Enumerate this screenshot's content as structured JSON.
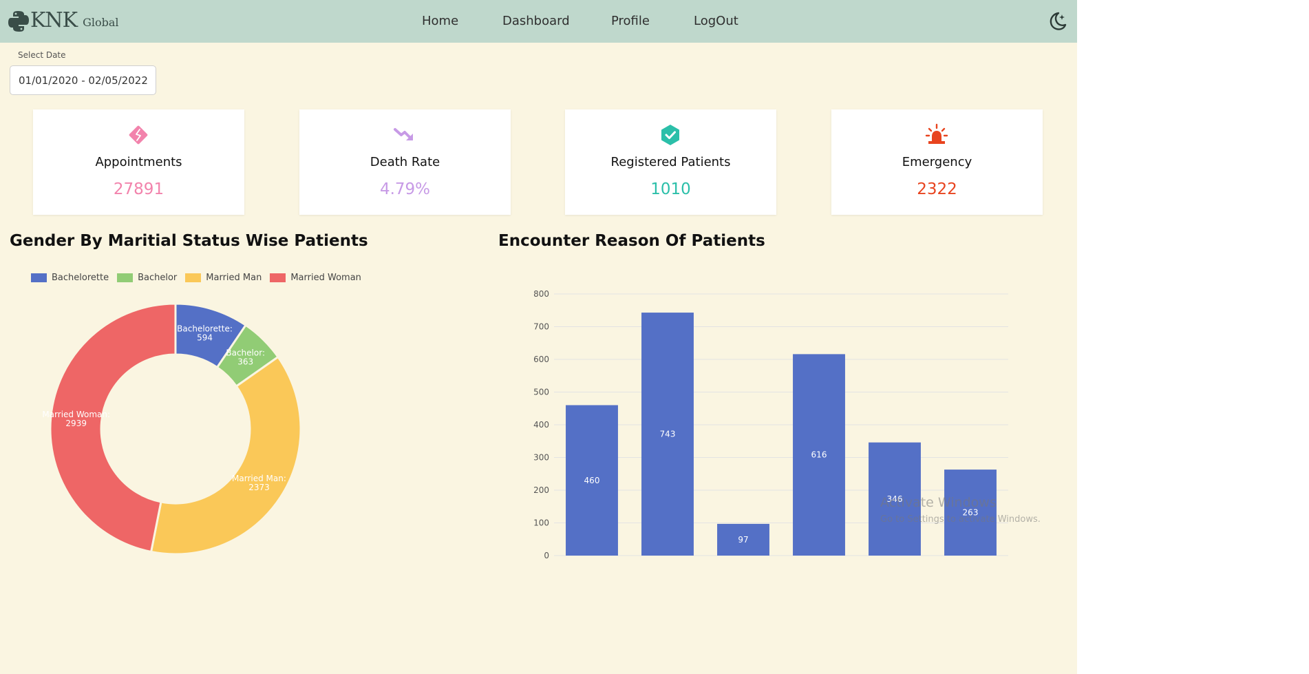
{
  "brand": {
    "name": "KNK",
    "sub": "Global"
  },
  "nav": {
    "home": "Home",
    "dashboard": "Dashboard",
    "profile": "Profile",
    "logout": "LogOut"
  },
  "filters": {
    "date_label": "Select Date",
    "date_range": "01/01/2020 - 02/05/2022"
  },
  "cards": [
    {
      "title": "Appointments",
      "value": "27891",
      "color": "#f283ac",
      "icon": "diamond-icon"
    },
    {
      "title": "Death Rate",
      "value": "4.79%",
      "color": "#c79ae6",
      "icon": "trend-down-icon"
    },
    {
      "title": "Registered Patients",
      "value": "1010",
      "color": "#2bbfa9",
      "icon": "check-badge-icon"
    },
    {
      "title": "Emergency",
      "value": "2322",
      "color": "#e8441f",
      "icon": "siren-icon"
    }
  ],
  "sections": {
    "donut_title": "Gender By Maritial Status Wise Patients",
    "bar_title": "Encounter Reason Of Patients"
  },
  "watermark": {
    "title": "Activate Windows",
    "sub": "Go to Settings to activate Windows."
  },
  "chart_data": [
    {
      "type": "pie",
      "title": "Gender By Maritial Status Wise Patients",
      "legend": "top",
      "slices": [
        {
          "label": "Bachelorette",
          "value": 594,
          "color": "#5470c6"
        },
        {
          "label": "Bachelor",
          "value": 363,
          "color": "#91cc75"
        },
        {
          "label": "Married Man",
          "value": 2373,
          "color": "#fac858"
        },
        {
          "label": "Married Woman",
          "value": 2939,
          "color": "#ee6666"
        }
      ]
    },
    {
      "type": "bar",
      "title": "Encounter Reason Of Patients",
      "values": [
        460,
        743,
        97,
        616,
        346,
        263
      ],
      "ylim": [
        0,
        800
      ],
      "yticks": [
        0,
        100,
        200,
        300,
        400,
        500,
        600,
        700,
        800
      ],
      "color": "#5470c6",
      "grid": true
    }
  ]
}
